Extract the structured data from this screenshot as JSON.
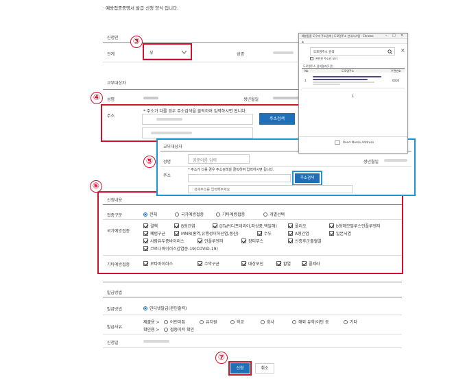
{
  "page": {
    "intro": "· 예방접종증명서 발급 신청 양식 입니다."
  },
  "applicant": {
    "section": "신청인",
    "relation_label": "관계",
    "relation_value": "부",
    "name_label": "성명"
  },
  "recipient": {
    "section": "교부대상자",
    "name_label": "성명",
    "birth_label": "생년월일",
    "address_label": "주소",
    "address_note": "* 주소가 다를 경우 주소검색을 클릭하여 입력하시면 됩니다.",
    "search_button": "주소검색"
  },
  "popup": {
    "title": "예방접종 도우미 주소검색 | 도로명주소 안내시스템 - Chrome",
    "search_value": "도로명주소 검색",
    "option": "관련된 주소만 보기",
    "result_count": "도로명주소 검색결과(1건)",
    "col_no": "No",
    "col_address": "도로명주소",
    "col_zip": "우편번호",
    "row_no": "1",
    "row_zip": "0000",
    "page_no": "1",
    "footer": "Road Name Address"
  },
  "expanded": {
    "section": "교부대상자",
    "name_label": "성명",
    "name_value": "영문이름 입력",
    "birth_label": "생년월일",
    "address_label": "주소",
    "address_note": "* 주소가 다를 경우 주소검색을 클릭하여 입력하시면 됩니다.",
    "search_button": "주소검색",
    "detail_placeholder": "상세주소를 입력해주세요"
  },
  "details": {
    "section": "신청내용",
    "category_label": "접종구분",
    "category_options": [
      "전체",
      "국가예방접종",
      "기타예방접종",
      "개별선택"
    ],
    "national_label": "국가예방접종",
    "national_items": [
      "결핵",
      "B형간염",
      "DTaP(디프테리아,파상풍,백일해)",
      "폴리오",
      "b형헤모필루스인플루엔자",
      "폐렴구균",
      "MMR(홍역,유행성이하선염,풍진)",
      "수두",
      "A형간염",
      "일본뇌염",
      "사람유두종바이러스",
      "인플루엔자",
      "장티푸스",
      "신증후군출혈열",
      "코로나바이러스감염증-19(COVID-19)"
    ],
    "other_label": "기타예방접종",
    "other_items": [
      "로타바이러스",
      "수막구균",
      "대상포진",
      "황열",
      "콜레라"
    ]
  },
  "issuance": {
    "section": "발급방법",
    "method_label": "발급방법",
    "method_value": "인터넷발급(본인출력)",
    "reason_label": "발급사유",
    "reasons_row1": [
      "제출용 >",
      "어린이집",
      "유치원",
      "학교",
      "회사",
      "해외 유학/이민 등",
      "기타"
    ],
    "reasons_row2": [
      "확인용 >",
      "접종이력 확인"
    ],
    "date_label": "신청일"
  },
  "buttons": {
    "submit": "신청",
    "cancel": "취소"
  },
  "markers": [
    "③",
    "④",
    "⑤",
    "⑥",
    "⑦"
  ],
  "colors": {
    "marker_red": "#d0112b",
    "highlight_blue": "#1a96d4",
    "button_blue": "#1f6fb9"
  }
}
